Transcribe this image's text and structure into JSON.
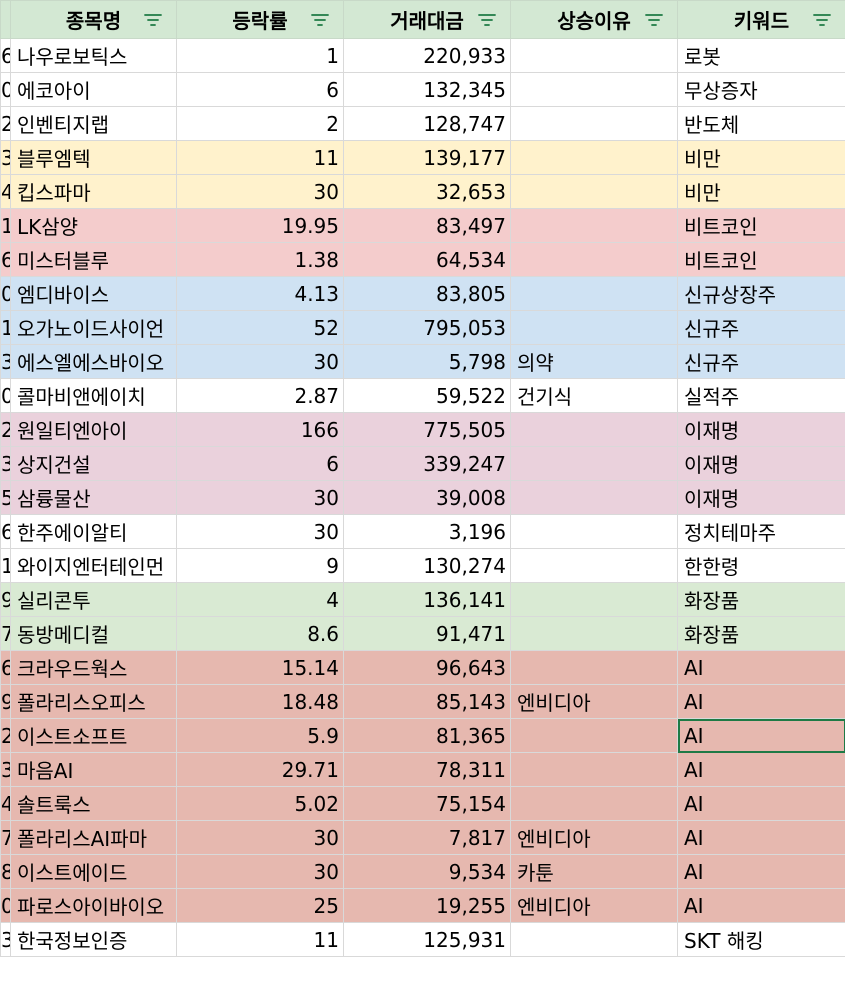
{
  "header": {
    "col1": "종목명",
    "col2": "등락률",
    "col3": "거래대금",
    "col4": "상승이유",
    "col5": "키워드",
    "filter_icon": "filter-icon"
  },
  "colors": {
    "header": "#d3e8d3",
    "yellow": "#fff2cc",
    "red": "#f4cccc",
    "blue": "#cfe2f3",
    "purple": "#ead1dc",
    "green": "#d9ead3",
    "salmon": "#e6b8af",
    "selection": "#1e7a45"
  },
  "rows": [
    {
      "stub": "6",
      "name": "나우로보틱스",
      "rate": "1",
      "amount": "220,933",
      "reason": "",
      "keyword": "로봇",
      "color": "white"
    },
    {
      "stub": "0",
      "name": "에코아이",
      "rate": "6",
      "amount": "132,345",
      "reason": "",
      "keyword": "무상증자",
      "color": "white"
    },
    {
      "stub": "2",
      "name": "인벤티지랩",
      "rate": "2",
      "amount": "128,747",
      "reason": "",
      "keyword": "반도체",
      "color": "white"
    },
    {
      "stub": "3",
      "name": "블루엠텍",
      "rate": "11",
      "amount": "139,177",
      "reason": "",
      "keyword": "비만",
      "color": "yellow"
    },
    {
      "stub": "4",
      "name": "킵스파마",
      "rate": "30",
      "amount": "32,653",
      "reason": "",
      "keyword": "비만",
      "color": "yellow"
    },
    {
      "stub": "1",
      "name": "LK삼양",
      "rate": "19.95",
      "amount": "83,497",
      "reason": "",
      "keyword": "비트코인",
      "color": "red"
    },
    {
      "stub": "6",
      "name": "미스터블루",
      "rate": "1.38",
      "amount": "64,534",
      "reason": "",
      "keyword": "비트코인",
      "color": "red"
    },
    {
      "stub": "0",
      "name": "엠디바이스",
      "rate": "4.13",
      "amount": "83,805",
      "reason": "",
      "keyword": "신규상장주",
      "color": "blue"
    },
    {
      "stub": "1",
      "name": "오가노이드사이언",
      "rate": "52",
      "amount": "795,053",
      "reason": "",
      "keyword": "신규주",
      "color": "blue"
    },
    {
      "stub": "3",
      "name": "에스엘에스바이오",
      "rate": "30",
      "amount": "5,798",
      "reason": "의약",
      "keyword": "신규주",
      "color": "blue"
    },
    {
      "stub": "0",
      "name": "콜마비앤에이치",
      "rate": "2.87",
      "amount": "59,522",
      "reason": "건기식",
      "keyword": "실적주",
      "color": "white"
    },
    {
      "stub": "2",
      "name": "원일티엔아이",
      "rate": "166",
      "amount": "775,505",
      "reason": "",
      "keyword": "이재명",
      "color": "purple"
    },
    {
      "stub": "3",
      "name": "상지건설",
      "rate": "6",
      "amount": "339,247",
      "reason": "",
      "keyword": "이재명",
      "color": "purple"
    },
    {
      "stub": "5",
      "name": "삼륭물산",
      "rate": "30",
      "amount": "39,008",
      "reason": "",
      "keyword": "이재명",
      "color": "purple"
    },
    {
      "stub": "6",
      "name": "한주에이알티",
      "rate": "30",
      "amount": "3,196",
      "reason": "",
      "keyword": "정치테마주",
      "color": "white"
    },
    {
      "stub": "1",
      "name": "와이지엔터테인먼",
      "rate": "9",
      "amount": "130,274",
      "reason": "",
      "keyword": "한한령",
      "color": "white"
    },
    {
      "stub": "9",
      "name": "실리콘투",
      "rate": "4",
      "amount": "136,141",
      "reason": "",
      "keyword": "화장품",
      "color": "green"
    },
    {
      "stub": "7",
      "name": "동방메디컬",
      "rate": "8.6",
      "amount": "91,471",
      "reason": "",
      "keyword": "화장품",
      "color": "green"
    },
    {
      "stub": "6",
      "name": "크라우드웍스",
      "rate": "15.14",
      "amount": "96,643",
      "reason": "",
      "keyword": "AI",
      "color": "salmon"
    },
    {
      "stub": "9",
      "name": "폴라리스오피스",
      "rate": "18.48",
      "amount": "85,143",
      "reason": "엔비디아",
      "keyword": "AI",
      "color": "salmon"
    },
    {
      "stub": "2",
      "name": "이스트소프트",
      "rate": "5.9",
      "amount": "81,365",
      "reason": "",
      "keyword": "AI",
      "color": "salmon",
      "selected": true
    },
    {
      "stub": "3",
      "name": "마음AI",
      "rate": "29.71",
      "amount": "78,311",
      "reason": "",
      "keyword": "AI",
      "color": "salmon"
    },
    {
      "stub": "4",
      "name": "솔트룩스",
      "rate": "5.02",
      "amount": "75,154",
      "reason": "",
      "keyword": "AI",
      "color": "salmon"
    },
    {
      "stub": "7",
      "name": "폴라리스AI파마",
      "rate": "30",
      "amount": "7,817",
      "reason": "엔비디아",
      "keyword": "AI",
      "color": "salmon"
    },
    {
      "stub": "8",
      "name": "이스트에이드",
      "rate": "30",
      "amount": "9,534",
      "reason": "카툰",
      "keyword": "AI",
      "color": "salmon"
    },
    {
      "stub": "0",
      "name": "파로스아이바이오",
      "rate": "25",
      "amount": "19,255",
      "reason": "엔비디아",
      "keyword": "AI",
      "color": "salmon"
    },
    {
      "stub": "3",
      "name": "한국정보인증",
      "rate": "11",
      "amount": "125,931",
      "reason": "",
      "keyword": "SKT 해킹",
      "color": "white"
    }
  ]
}
